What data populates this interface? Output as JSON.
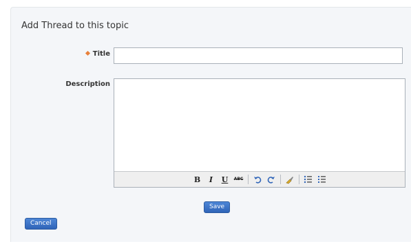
{
  "form": {
    "heading": "Add Thread to this topic",
    "title_label": "Title",
    "title_value": "",
    "description_label": "Description",
    "description_value": ""
  },
  "toolbar": {
    "bold": "B",
    "italic": "I",
    "underline": "U",
    "strike": "ABC",
    "icons": [
      "bold-icon",
      "italic-icon",
      "underline-icon",
      "strikethrough-icon",
      "undo-icon",
      "redo-icon",
      "clear-format-icon",
      "bullet-list-icon",
      "numbered-list-icon"
    ]
  },
  "actions": {
    "save_label": "Save",
    "cancel_label": "Cancel"
  },
  "colors": {
    "panel_bg": "#f4f6f9",
    "button_bg": "#3a6fc4",
    "required_marker": "#e8803a"
  }
}
